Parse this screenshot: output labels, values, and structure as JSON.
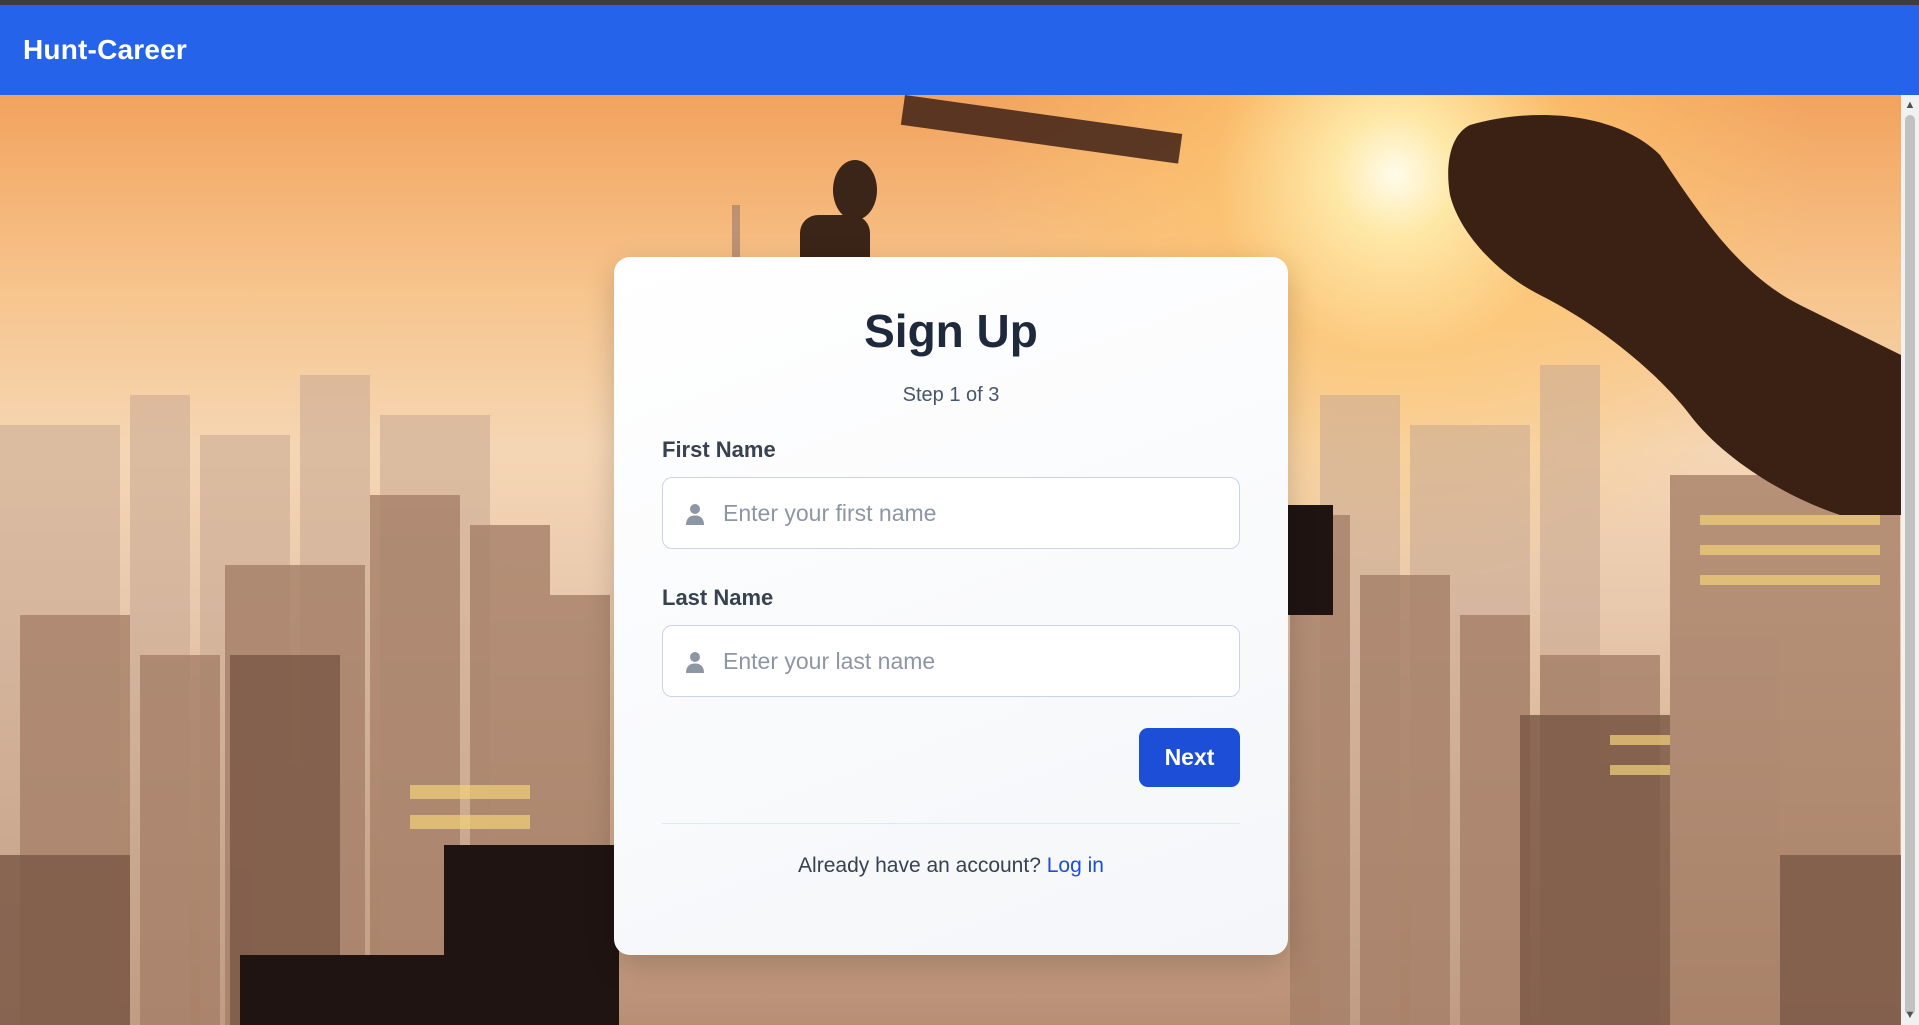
{
  "app": {
    "brand": "Hunt-Career"
  },
  "colors": {
    "navbar": "#2563eb",
    "primary_button": "#1d4ed8",
    "link": "#1d4ed8",
    "title": "#1e293b"
  },
  "signup": {
    "title": "Sign Up",
    "step": "Step 1 of 3",
    "first_name": {
      "label": "First Name",
      "placeholder": "Enter your first name",
      "value": "",
      "icon": "user-icon"
    },
    "last_name": {
      "label": "Last Name",
      "placeholder": "Enter your last name",
      "value": "",
      "icon": "user-icon"
    },
    "next_label": "Next",
    "footer": {
      "text": "Already have an account?",
      "link_label": "Log in"
    }
  },
  "background": {
    "type": "city skyline at sunset photo"
  }
}
